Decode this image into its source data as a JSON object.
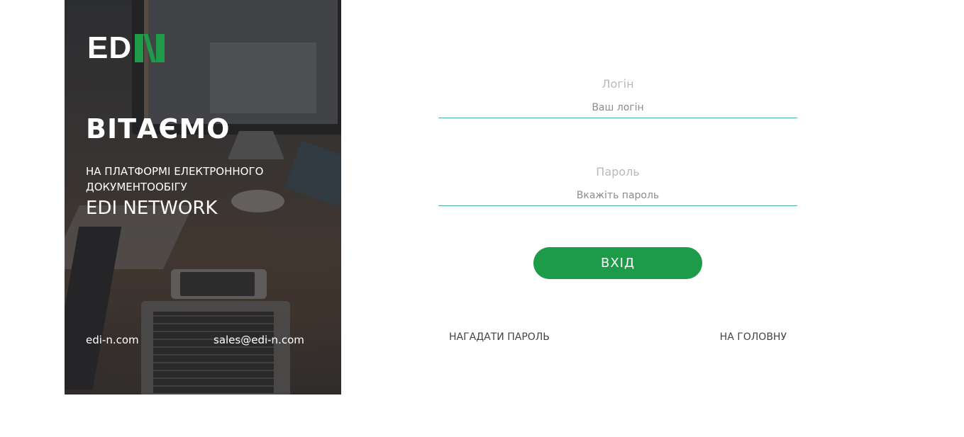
{
  "left_panel": {
    "logo_text": "ED",
    "logo_mark_icon": "edin-n-mark",
    "title": "ВІТАЄМО",
    "subtitle": "НА ПЛАТФОРМІ ЕЛЕКТРОННОГО ДОКУМЕНТООБІГУ",
    "brand": "EDI NETWORK",
    "website": "edi-n.com",
    "email": "sales@edi-n.com"
  },
  "form": {
    "login_label": "Логін",
    "login_placeholder": "Ваш логін",
    "login_value": "",
    "password_label": "Пароль",
    "password_placeholder": "Вкажіть пароль",
    "password_value": "",
    "submit_label": "ВХІД",
    "forgot_password": "НАГАДАТИ ПАРОЛЬ",
    "home_link": "НА ГОЛОВНУ"
  },
  "colors": {
    "accent_green": "#1e9b48",
    "input_underline": "#4db0ad",
    "label_gray": "#b9b9b9",
    "link_dark": "#444444"
  }
}
